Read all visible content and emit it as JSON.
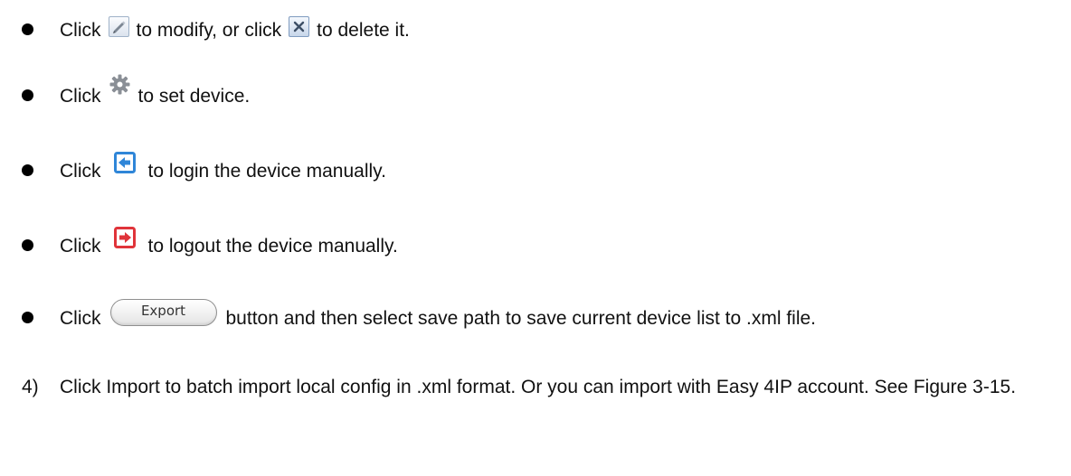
{
  "bullets": [
    {
      "prefix": "Click",
      "middle": "to modify, or click",
      "suffix": "to delete it.",
      "icons": [
        "edit-icon",
        "delete-icon"
      ]
    },
    {
      "prefix": "Click",
      "suffix": "to set device.",
      "icons": [
        "gear-icon"
      ]
    },
    {
      "prefix": "Click",
      "suffix": "to login the device manually.",
      "icons": [
        "login-icon"
      ]
    },
    {
      "prefix": "Click",
      "suffix": "to logout the device manually.",
      "icons": [
        "logout-icon"
      ]
    },
    {
      "prefix": "Click",
      "button_label": "Export",
      "suffix": "button and then select save path to save current device list to .xml  file."
    }
  ],
  "step": {
    "number": "4)",
    "text": "Click Import to batch import local config in .xml  format. Or you can import with Easy 4IP account. See Figure 3-15."
  },
  "colors": {
    "login_icon": "#2f86d8",
    "logout_icon": "#e0343a",
    "gear_icon": "#8a8f96"
  }
}
